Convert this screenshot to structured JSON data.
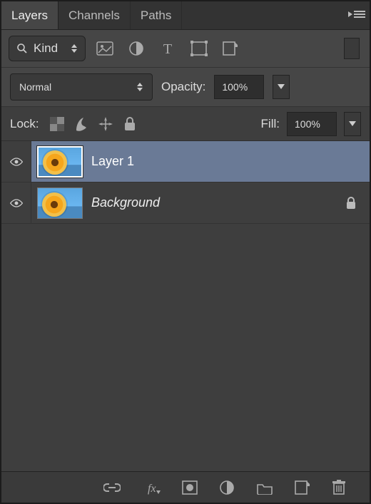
{
  "tabs": {
    "layers": "Layers",
    "channels": "Channels",
    "paths": "Paths"
  },
  "filter": {
    "kind_label": "Kind"
  },
  "blend": {
    "mode": "Normal",
    "opacity_label": "Opacity:",
    "opacity_value": "100%"
  },
  "lock": {
    "label": "Lock:",
    "fill_label": "Fill:",
    "fill_value": "100%"
  },
  "layers": [
    {
      "name": "Layer 1",
      "italic": false,
      "locked": false,
      "selected": true
    },
    {
      "name": "Background",
      "italic": true,
      "locked": true,
      "selected": false
    }
  ]
}
